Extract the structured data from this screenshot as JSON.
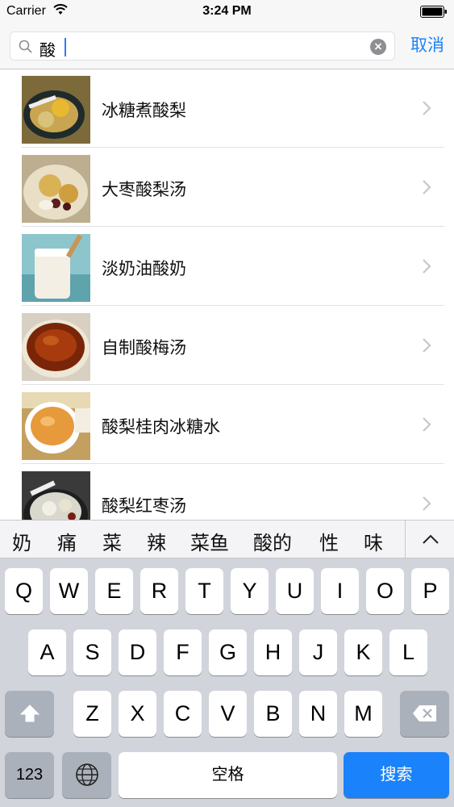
{
  "status": {
    "carrier": "Carrier",
    "time": "3:24 PM"
  },
  "search": {
    "query": "酸",
    "cancel_label": "取消"
  },
  "results": [
    {
      "label": "冰糖煮酸梨",
      "thumbnail": "pear dessert bowl"
    },
    {
      "label": "大枣酸梨汤",
      "thumbnail": "jujube pear soup"
    },
    {
      "label": "淡奶油酸奶",
      "thumbnail": "yogurt jar"
    },
    {
      "label": "自制酸梅汤",
      "thumbnail": "plum drink bowl"
    },
    {
      "label": "酸梨桂肉冰糖水",
      "thumbnail": "cup of tea"
    },
    {
      "label": "酸梨红枣汤",
      "thumbnail": "pear jujube soup"
    }
  ],
  "candidates": [
    "奶",
    "痛",
    "菜",
    "辣",
    "菜鱼",
    "酸的",
    "性",
    "味"
  ],
  "keyboard": {
    "row1": [
      "Q",
      "W",
      "E",
      "R",
      "T",
      "Y",
      "U",
      "I",
      "O",
      "P"
    ],
    "row2": [
      "A",
      "S",
      "D",
      "F",
      "G",
      "H",
      "J",
      "K",
      "L"
    ],
    "row3": [
      "Z",
      "X",
      "C",
      "V",
      "B",
      "N",
      "M"
    ],
    "numbers_label": "123",
    "space_label": "空格",
    "search_label": "搜索"
  },
  "icons": {
    "shift": "shift-icon",
    "delete": "delete-icon",
    "globe": "globe-icon",
    "collapse": "chevron-up-icon"
  },
  "colors": {
    "accent": "#1a82fb",
    "keyboard_bg": "#d1d4da"
  }
}
